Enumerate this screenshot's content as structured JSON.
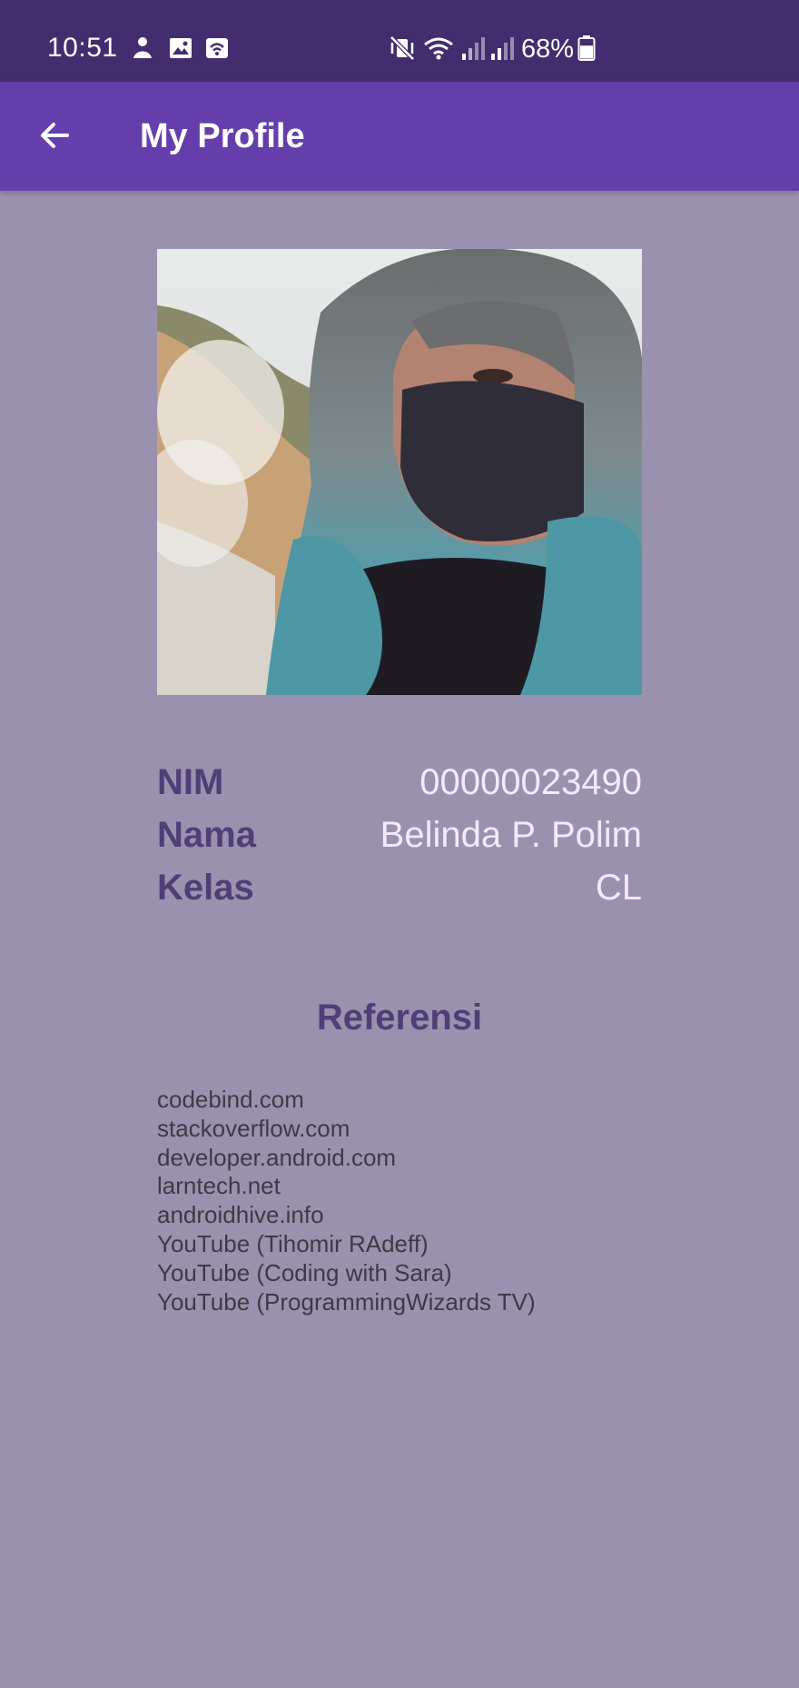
{
  "status_bar": {
    "time": "10:51",
    "battery_percent": "68%",
    "left_icons": [
      "notification-icon",
      "gallery-icon",
      "wifi-calling-icon"
    ],
    "right_icons": [
      "vibrate-mute-icon",
      "wifi-icon",
      "signal-icon",
      "signal-icon",
      "battery-icon"
    ],
    "battery_level": 0.68
  },
  "app_bar": {
    "title": "My Profile",
    "back_icon": "arrow-back-icon",
    "color": "#643fab"
  },
  "profile": {
    "photo": "profile-photo",
    "rows": [
      {
        "label": "NIM",
        "value": "00000023490"
      },
      {
        "label": "Nama",
        "value": "Belinda P. Polim"
      },
      {
        "label": "Kelas",
        "value": "CL"
      }
    ]
  },
  "references": {
    "title": "Referensi",
    "items": [
      "codebind.com",
      "stackoverflow.com",
      "developer.android.com",
      "larntech.net",
      "androidhive.info",
      "YouTube (Tihomir RAdeff)",
      "YouTube (Coding with Sara)",
      "YouTube (ProgrammingWizards TV)"
    ]
  },
  "colors": {
    "status_bar": "#432d6e",
    "background": "#9a91af",
    "label_text": "#4f3f76",
    "value_text": "#f2e9ff"
  }
}
